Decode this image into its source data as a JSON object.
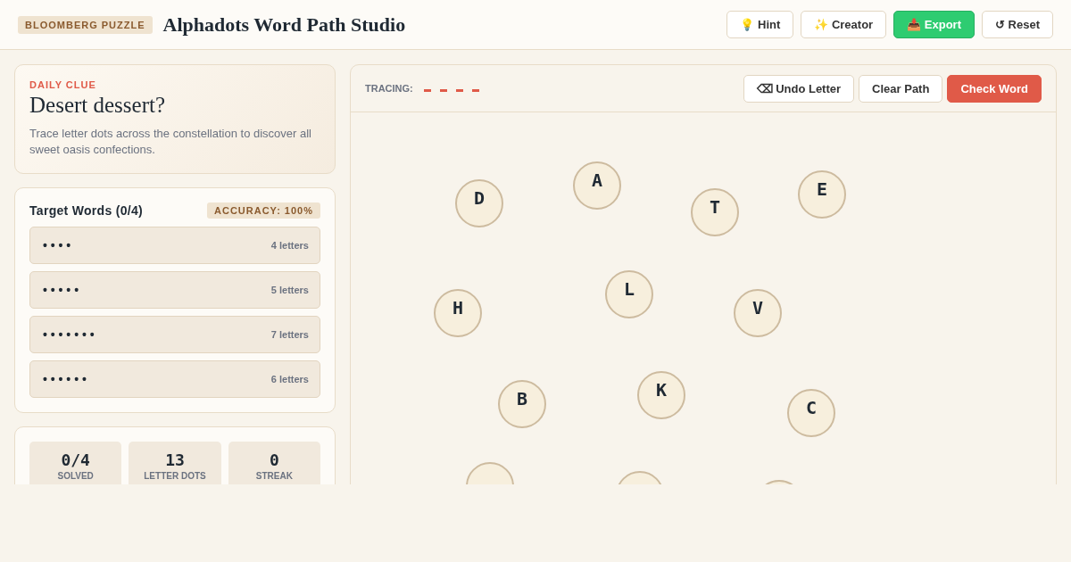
{
  "header": {
    "badge": "BLOOMBERG PUZZLE",
    "title": "Alphadots Word Path Studio",
    "buttons": [
      {
        "label": "💡 Hint",
        "kind": "plain"
      },
      {
        "label": "✨ Creator",
        "kind": "plain"
      },
      {
        "label": "📥 Export",
        "kind": "primary"
      },
      {
        "label": "↺ Reset",
        "kind": "plain"
      }
    ]
  },
  "clue": {
    "eyebrow": "DAILY CLUE",
    "title": "Desert dessert?",
    "description": "Trace letter dots across the constellation to discover all sweet oasis confections."
  },
  "targets": {
    "title": "Target Words (0/4)",
    "accuracy": "ACCURACY: 100%",
    "words": [
      {
        "mask": "• • • •",
        "length": "4 letters"
      },
      {
        "mask": "• • • • •",
        "length": "5 letters"
      },
      {
        "mask": "• • • • • • •",
        "length": "7 letters"
      },
      {
        "mask": "• • • • • •",
        "length": "6 letters"
      }
    ]
  },
  "stats": [
    {
      "value": "0/4",
      "label": "SOLVED"
    },
    {
      "value": "13",
      "label": "LETTER DOTS"
    },
    {
      "value": "0",
      "label": "STREAK"
    }
  ],
  "board": {
    "tracing_label": "TRACING:",
    "tracing_slots": [
      {
        "filled": false
      },
      {
        "filled": false
      },
      {
        "filled": false
      },
      {
        "filled": false
      }
    ],
    "buttons": [
      {
        "label": "⌫ Undo Letter",
        "kind": "plain"
      },
      {
        "label": "Clear Path",
        "kind": "plain"
      },
      {
        "label": "Check Word",
        "kind": "danger"
      }
    ],
    "dots": [
      {
        "letter": "D"
      },
      {
        "letter": "A"
      },
      {
        "letter": "T"
      },
      {
        "letter": "E"
      },
      {
        "letter": "H"
      },
      {
        "letter": "L"
      },
      {
        "letter": "V"
      },
      {
        "letter": "B"
      },
      {
        "letter": "K"
      },
      {
        "letter": "C"
      }
    ]
  }
}
